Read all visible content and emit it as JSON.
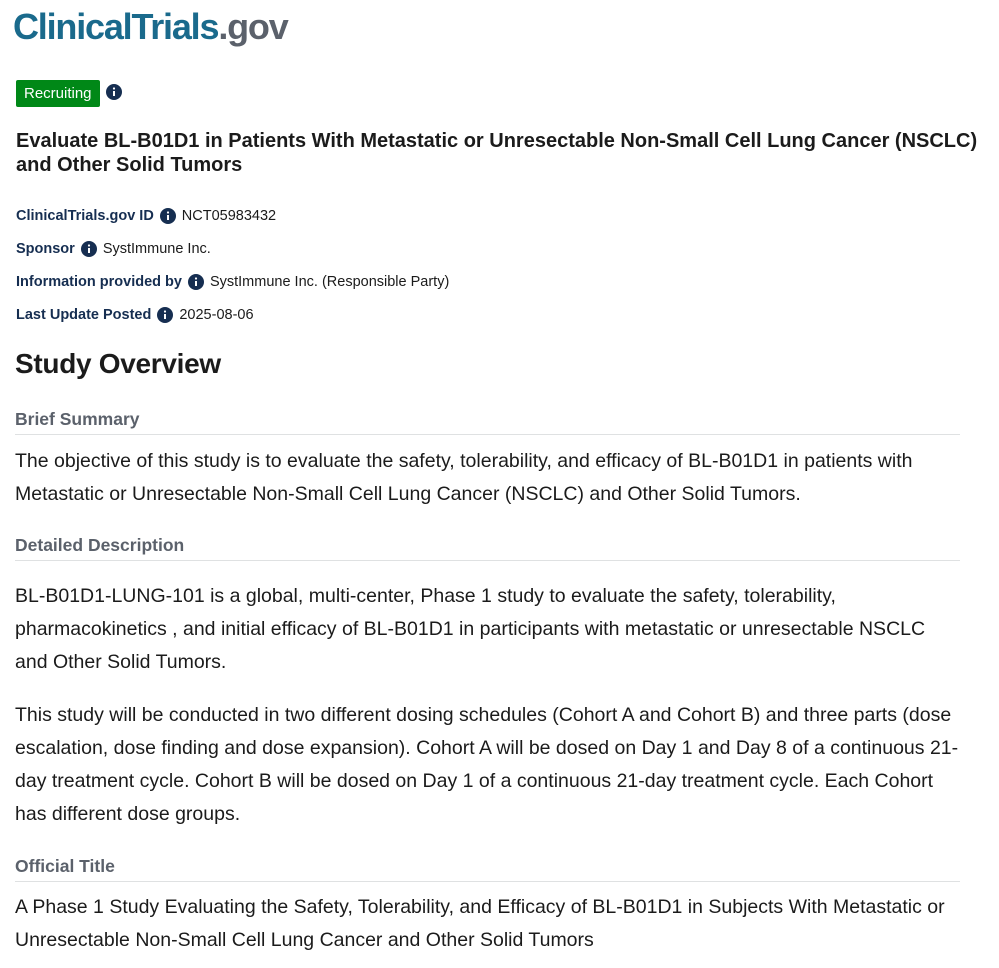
{
  "logo": {
    "brand": "ClinicalTrials",
    "suffix": ".gov"
  },
  "status": {
    "label": "Recruiting",
    "color": "#008817"
  },
  "study": {
    "title": "Evaluate BL-B01D1 in Patients With Metastatic or Unresectable Non-Small Cell Lung Cancer (NSCLC) and Other Solid Tumors"
  },
  "meta": [
    {
      "label": "ClinicalTrials.gov ID",
      "value": "NCT05983432"
    },
    {
      "label": "Sponsor",
      "value": "SystImmune Inc."
    },
    {
      "label": "Information provided by",
      "value": "SystImmune Inc. (Responsible Party)"
    },
    {
      "label": "Last Update Posted",
      "value": "2025-08-06"
    }
  ],
  "overview": {
    "heading": "Study Overview",
    "brief_summary_label": "Brief Summary",
    "brief_summary": "The objective of this study is to evaluate the safety, tolerability, and efficacy of BL-B01D1 in patients with Metastatic or Unresectable Non-Small Cell Lung Cancer (NSCLC) and Other Solid Tumors.",
    "detailed_description_label": "Detailed Description",
    "detailed_description": [
      "BL-B01D1-LUNG-101 is a global, multi-center, Phase 1 study to evaluate the safety, tolerability, pharmacokinetics , and initial efficacy of BL-B01D1 in participants with metastatic or unresectable NSCLC and Other Solid Tumors.",
      "This study will be conducted in two different dosing schedules (Cohort A and Cohort B) and three parts (dose escalation, dose finding and dose expansion). Cohort A will be dosed on Day 1 and Day 8 of a continuous 21-day treatment cycle. Cohort B will be dosed on Day 1 of a continuous 21-day treatment cycle. Each Cohort has different dose groups."
    ],
    "official_title_label": "Official Title",
    "official_title": "A Phase 1 Study Evaluating the Safety, Tolerability, and Efficacy of BL-B01D1 in Subjects With Metastatic or Unresectable Non-Small Cell Lung Cancer and Other Solid Tumors"
  },
  "colors": {
    "brand": "#1a6a8c",
    "gov": "#5b616b",
    "label": "#162e51",
    "info_icon": "#162e51"
  },
  "icons": {
    "info": "info-icon"
  }
}
